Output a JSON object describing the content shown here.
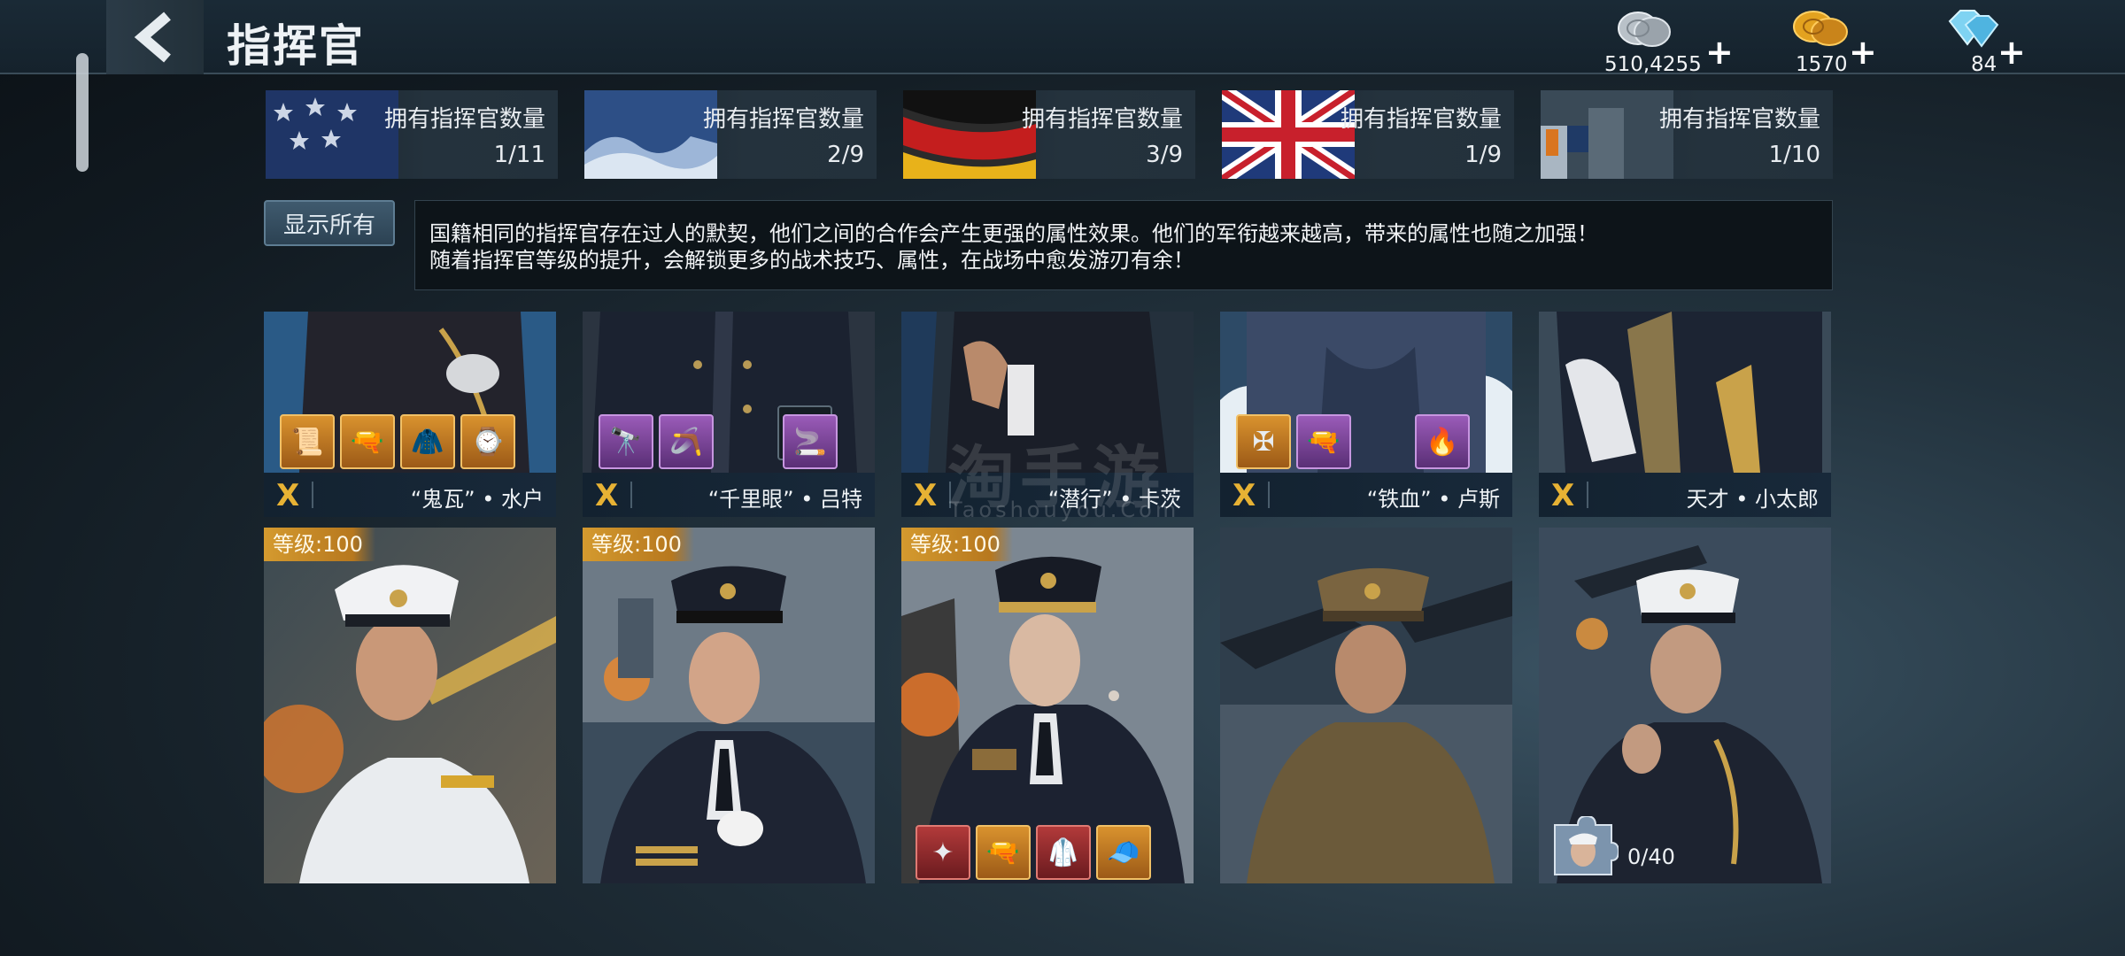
{
  "header": {
    "title": "指挥官",
    "currencies": [
      {
        "icon": "silver-coins-icon",
        "amount": "510,4255"
      },
      {
        "icon": "gold-coins-icon",
        "amount": "1570"
      },
      {
        "icon": "diamond-icon",
        "amount": "84"
      }
    ],
    "plus": "+"
  },
  "nations": [
    {
      "label": "拥有指挥官数量",
      "count": "1/11",
      "flag": "usa-flag"
    },
    {
      "label": "拥有指挥官数量",
      "count": "2/9",
      "flag": "japan-flag"
    },
    {
      "label": "拥有指挥官数量",
      "count": "3/9",
      "flag": "germany-flag"
    },
    {
      "label": "拥有指挥官数量",
      "count": "1/9",
      "flag": "uk-flag"
    },
    {
      "label": "拥有指挥官数量",
      "count": "1/10",
      "flag": "soviet-flag"
    }
  ],
  "show_all": "显示所有",
  "info": {
    "line1": "国籍相同的指挥官存在过人的默契，他们之间的合作会产生更强的属性效果。他们的军衔越来越高，带来的属性也随之加强！",
    "line2": "随着指挥官等级的提升，会解锁更多的战术技巧、属性，在战场中愈发游刃有余！"
  },
  "top_cards": [
    {
      "rank": "X",
      "name": "“鬼瓦” • 水户",
      "equipment": [
        "scroll-icon",
        "rifle-icon",
        "jacket-icon",
        "pocket-watch-icon"
      ]
    },
    {
      "rank": "X",
      "name": "“千里眼” • 吕特",
      "equipment": [
        "telescope-icon",
        "boomerang-icon",
        "pipe-icon"
      ]
    },
    {
      "rank": "X",
      "name": "“潜行” • 卡茨",
      "equipment": []
    },
    {
      "rank": "X",
      "name": "“铁血” • 卢斯",
      "equipment": [
        "medal-cross-icon",
        "pistol-icon",
        "lighter-icon"
      ]
    },
    {
      "rank": "X",
      "name": "天才 • 小太郎",
      "equipment": []
    }
  ],
  "bottom_cards": [
    {
      "level": "等级:100"
    },
    {
      "level": "等级:100"
    },
    {
      "level": "等级:100",
      "equipment": [
        "medal-star-icon",
        "revolver-icon",
        "coat-icon",
        "cap-icon"
      ]
    },
    {},
    {
      "fragment_count": "0/40"
    }
  ],
  "watermark": {
    "main": "淘手游",
    "sub": "Taoshouyou.Com"
  }
}
